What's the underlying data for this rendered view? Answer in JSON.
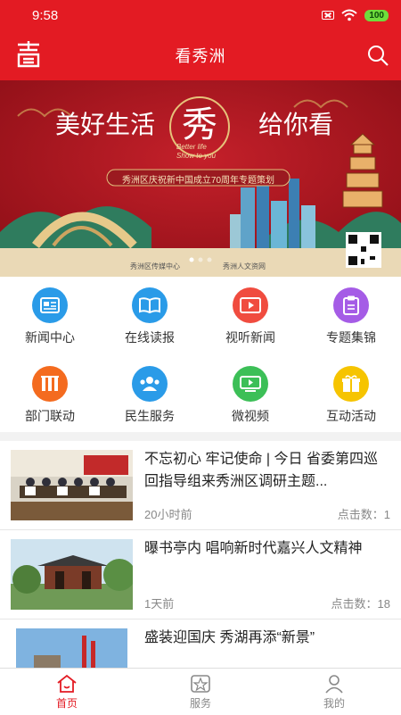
{
  "status": {
    "time": "9:58",
    "battery": "100"
  },
  "header": {
    "title": "看秀洲"
  },
  "banner": {
    "headline_left": "美好生活",
    "headline_center": "秀",
    "headline_right": "给你看",
    "subtitle_en_1": "Better life",
    "subtitle_en_2": "Show to you",
    "ribbon": "秀洲区庆祝新中国成立70周年专题策划",
    "footer_left": "秀洲区传媒中心",
    "footer_right": "秀洲人文资网"
  },
  "grid": [
    {
      "label": "新闻中心",
      "color": "#2a9be8",
      "icon": "newspaper-icon"
    },
    {
      "label": "在线读报",
      "color": "#2a9be8",
      "icon": "book-icon"
    },
    {
      "label": "视听新闻",
      "color": "#f04c3f",
      "icon": "video-film-icon"
    },
    {
      "label": "专题集锦",
      "color": "#a55ce6",
      "icon": "clipboard-icon"
    },
    {
      "label": "部门联动",
      "color": "#f46b1f",
      "icon": "columns-icon"
    },
    {
      "label": "民生服务",
      "color": "#2a9be8",
      "icon": "people-icon"
    },
    {
      "label": "微视频",
      "color": "#3cbf57",
      "icon": "video-screen-icon"
    },
    {
      "label": "互动活动",
      "color": "#f6c400",
      "icon": "gift-icon"
    }
  ],
  "news": [
    {
      "title": "不忘初心 牢记使命 | 今日 省委第四巡回指导组来秀洲区调研主题...",
      "time": "20小时前",
      "views": "点击数：1"
    },
    {
      "title": "曝书亭内 唱响新时代嘉兴人文精神",
      "time": "1天前",
      "views": "点击数：18"
    },
    {
      "title": "盛装迎国庆 秀湖再添“新景”",
      "time": "",
      "views": ""
    }
  ],
  "tabs": [
    {
      "label": "首页",
      "active": true
    },
    {
      "label": "服务",
      "active": false
    },
    {
      "label": "我的",
      "active": false
    }
  ],
  "colors": {
    "brand": "#e31b23"
  }
}
